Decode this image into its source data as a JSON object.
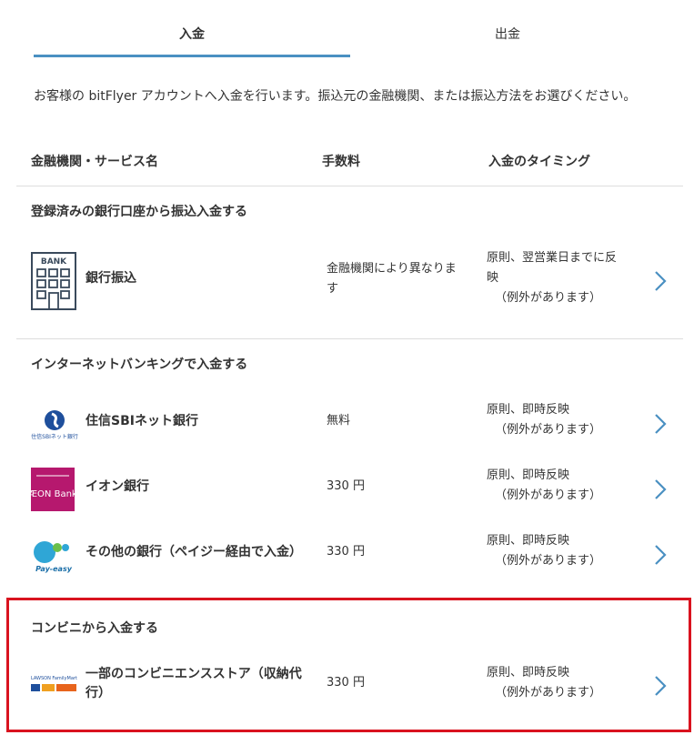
{
  "tabs": [
    {
      "label": "入金",
      "active": true
    },
    {
      "label": "出金",
      "active": false
    }
  ],
  "intro": "お客様の bitFlyer アカウントへ入金を行います。振込元の金融機関、または振込方法をお選びください。",
  "columns": {
    "name": "金融機関・サービス名",
    "fee": "手数料",
    "timing": "入金のタイミング"
  },
  "sections": [
    {
      "title": "登録済みの銀行口座から振込入金する",
      "rows": [
        {
          "icon": "bank-building-icon",
          "logo_text": "BANK",
          "name": "銀行振込",
          "fee": "金融機関により異なりま\nす",
          "timing": "原則、翌営業日までに反\n映",
          "note": "（例外があります）"
        }
      ]
    },
    {
      "title": "インターネットバンキングで入金する",
      "rows": [
        {
          "icon": "sbi-net-bank-logo",
          "logo_text": "住信SBIネット銀行",
          "name": "住信SBIネット銀行",
          "fee": "無料",
          "timing": "原則、即時反映",
          "note": "（例外があります）"
        },
        {
          "icon": "aeon-bank-logo",
          "logo_text": "ÆON Bank",
          "name": "イオン銀行",
          "fee": "330 円",
          "timing": "原則、即時反映",
          "note": "（例外があります）"
        },
        {
          "icon": "pay-easy-logo",
          "logo_text": "Pay-easy",
          "name": "その他の銀行（ペイジー経由で入金）",
          "fee": "330 円",
          "timing": "原則、即時反映",
          "note": "（例外があります）"
        }
      ]
    },
    {
      "title": "コンビニから入金する",
      "highlighted": true,
      "rows": [
        {
          "icon": "convenience-store-logos",
          "logo_text": "LAWSON FamilyMart",
          "name": "一部のコンビニエンスストア（収納代\n行）",
          "fee": "330 円",
          "timing": "原則、即時反映",
          "note": "（例外があります）"
        }
      ]
    }
  ],
  "colors": {
    "accent": "#4a90c2",
    "highlight_border": "#d9131f",
    "aeon_magenta": "#b6186e",
    "sbi_blue": "#1e4f9c"
  }
}
